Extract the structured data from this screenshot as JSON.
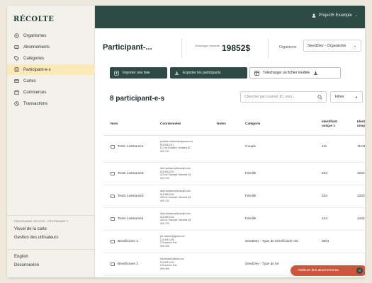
{
  "app": {
    "logo": "RÉCOLTE",
    "project": "Project5 Example"
  },
  "sidebar": {
    "items": [
      {
        "label": "Organismes",
        "icon": "organization-icon",
        "active": false
      },
      {
        "label": "Abonnements",
        "icon": "subscription-icon",
        "active": false
      },
      {
        "label": "Catégories",
        "icon": "tag-icon",
        "active": false
      },
      {
        "label": "Participant-e-s",
        "icon": "participants-icon",
        "active": true
      },
      {
        "label": "Cartes",
        "icon": "card-icon",
        "active": false
      },
      {
        "label": "Commerces",
        "icon": "store-icon",
        "active": false
      },
      {
        "label": "Transactions",
        "icon": "transactions-icon",
        "active": false
      }
    ],
    "program_label": "PROGRAMME SECOOS - PROGRAMME 1",
    "map_link": "Visuel de la carte",
    "users_link": "Gestion des utilisateurs",
    "language": "English",
    "logout": "Déconnexion"
  },
  "header": {
    "title": "Participant-...",
    "budget_label": "Enveloppe restante",
    "budget_value": "19852$",
    "org_label": "Organisme",
    "org_value": "SeedDev - Organisme"
  },
  "actions": {
    "import": "Importer une liste",
    "export": "Exporter les participants",
    "template": "Télécharger un fichier modèle"
  },
  "list": {
    "count_title": "8 participant-e-s",
    "search_placeholder": "Chercher par courriel, ID, nom...",
    "filter_label": "Filtrer"
  },
  "table": {
    "columns": [
      "Nom",
      "Coordonnées",
      "Notes",
      "Catégorie",
      "Identifiant unique 1",
      "Identifiant unique 2"
    ],
    "rows": [
      {
        "name": "Test1 Lastname1",
        "coord": [
          "jonathan.charbier@sigmundo.ca",
          "514 555-1111",
          "111 rue Example, Montréal QC",
          "H2K 1X1"
        ],
        "category": "Couple",
        "id1": "111",
        "id2": "11111"
      },
      {
        "name": "Test2 Lastname2",
        "coord": [
          "test2.lastname@example.com",
          "514 555-2222",
          "222 rue Example, Montréal QC",
          "H2K 1X2"
        ],
        "category": "Famille",
        "id1": "222",
        "id2": "22222"
      },
      {
        "name": "Test3 Lastname3",
        "coord": [
          "test3.lastname@example.com",
          "514 555-3333",
          "333 rue Example, Montréal QC",
          "H2K 1X3"
        ],
        "category": "Famille",
        "id1": "333",
        "id2": "33333"
      },
      {
        "name": "Test4 Lastname4",
        "coord": [
          "test4.lastname@example.com",
          "514 555-4444",
          "444 rue Example, Montréal QC",
          "H2K 1X4"
        ],
        "category": "Famille",
        "id1": "444",
        "id2": "44444"
      },
      {
        "name": "Bénéficiaire 1",
        "coord": [
          "jon.charbier@gmail.com",
          "123 555-1234",
          "123 avenue Test",
          "H0H 0H0"
        ],
        "category": "SeedDev - Type de bénéficiaire AB",
        "id1": "0001",
        "id2": ""
      },
      {
        "name": "Bénéficiaire 2",
        "coord": [
          "beneficiaire2@test.com",
          "123 555-1234",
          "123 avenue Test",
          "H0H 0H0"
        ],
        "category": "SeedDev - Type de bé",
        "id1": "",
        "id2": ""
      }
    ]
  },
  "fab": {
    "label": "Attribuer des abonnements",
    "count": "0"
  },
  "colors": {
    "topbar": "#2e4a45",
    "active_nav": "#fbe9b8",
    "fab": "#c9583d"
  }
}
